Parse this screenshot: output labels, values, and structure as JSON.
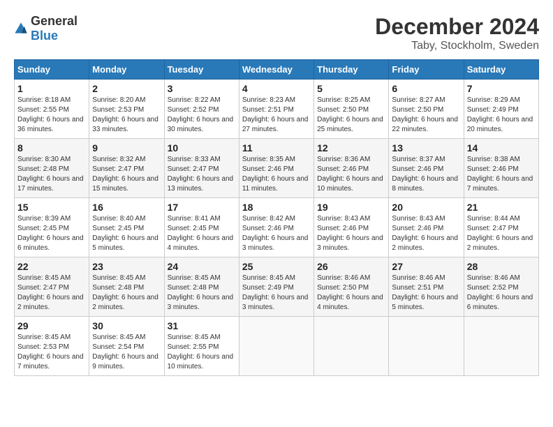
{
  "logo": {
    "general": "General",
    "blue": "Blue"
  },
  "title": "December 2024",
  "subtitle": "Taby, Stockholm, Sweden",
  "headers": [
    "Sunday",
    "Monday",
    "Tuesday",
    "Wednesday",
    "Thursday",
    "Friday",
    "Saturday"
  ],
  "weeks": [
    [
      {
        "day": "1",
        "sunrise": "8:18 AM",
        "sunset": "2:55 PM",
        "daylight": "6 hours and 36 minutes."
      },
      {
        "day": "2",
        "sunrise": "8:20 AM",
        "sunset": "2:53 PM",
        "daylight": "6 hours and 33 minutes."
      },
      {
        "day": "3",
        "sunrise": "8:22 AM",
        "sunset": "2:52 PM",
        "daylight": "6 hours and 30 minutes."
      },
      {
        "day": "4",
        "sunrise": "8:23 AM",
        "sunset": "2:51 PM",
        "daylight": "6 hours and 27 minutes."
      },
      {
        "day": "5",
        "sunrise": "8:25 AM",
        "sunset": "2:50 PM",
        "daylight": "6 hours and 25 minutes."
      },
      {
        "day": "6",
        "sunrise": "8:27 AM",
        "sunset": "2:50 PM",
        "daylight": "6 hours and 22 minutes."
      },
      {
        "day": "7",
        "sunrise": "8:29 AM",
        "sunset": "2:49 PM",
        "daylight": "6 hours and 20 minutes."
      }
    ],
    [
      {
        "day": "8",
        "sunrise": "8:30 AM",
        "sunset": "2:48 PM",
        "daylight": "6 hours and 17 minutes."
      },
      {
        "day": "9",
        "sunrise": "8:32 AM",
        "sunset": "2:47 PM",
        "daylight": "6 hours and 15 minutes."
      },
      {
        "day": "10",
        "sunrise": "8:33 AM",
        "sunset": "2:47 PM",
        "daylight": "6 hours and 13 minutes."
      },
      {
        "day": "11",
        "sunrise": "8:35 AM",
        "sunset": "2:46 PM",
        "daylight": "6 hours and 11 minutes."
      },
      {
        "day": "12",
        "sunrise": "8:36 AM",
        "sunset": "2:46 PM",
        "daylight": "6 hours and 10 minutes."
      },
      {
        "day": "13",
        "sunrise": "8:37 AM",
        "sunset": "2:46 PM",
        "daylight": "6 hours and 8 minutes."
      },
      {
        "day": "14",
        "sunrise": "8:38 AM",
        "sunset": "2:46 PM",
        "daylight": "6 hours and 7 minutes."
      }
    ],
    [
      {
        "day": "15",
        "sunrise": "8:39 AM",
        "sunset": "2:45 PM",
        "daylight": "6 hours and 6 minutes."
      },
      {
        "day": "16",
        "sunrise": "8:40 AM",
        "sunset": "2:45 PM",
        "daylight": "6 hours and 5 minutes."
      },
      {
        "day": "17",
        "sunrise": "8:41 AM",
        "sunset": "2:45 PM",
        "daylight": "6 hours and 4 minutes."
      },
      {
        "day": "18",
        "sunrise": "8:42 AM",
        "sunset": "2:46 PM",
        "daylight": "6 hours and 3 minutes."
      },
      {
        "day": "19",
        "sunrise": "8:43 AM",
        "sunset": "2:46 PM",
        "daylight": "6 hours and 3 minutes."
      },
      {
        "day": "20",
        "sunrise": "8:43 AM",
        "sunset": "2:46 PM",
        "daylight": "6 hours and 2 minutes."
      },
      {
        "day": "21",
        "sunrise": "8:44 AM",
        "sunset": "2:47 PM",
        "daylight": "6 hours and 2 minutes."
      }
    ],
    [
      {
        "day": "22",
        "sunrise": "8:45 AM",
        "sunset": "2:47 PM",
        "daylight": "6 hours and 2 minutes."
      },
      {
        "day": "23",
        "sunrise": "8:45 AM",
        "sunset": "2:48 PM",
        "daylight": "6 hours and 2 minutes."
      },
      {
        "day": "24",
        "sunrise": "8:45 AM",
        "sunset": "2:48 PM",
        "daylight": "6 hours and 3 minutes."
      },
      {
        "day": "25",
        "sunrise": "8:45 AM",
        "sunset": "2:49 PM",
        "daylight": "6 hours and 3 minutes."
      },
      {
        "day": "26",
        "sunrise": "8:46 AM",
        "sunset": "2:50 PM",
        "daylight": "6 hours and 4 minutes."
      },
      {
        "day": "27",
        "sunrise": "8:46 AM",
        "sunset": "2:51 PM",
        "daylight": "6 hours and 5 minutes."
      },
      {
        "day": "28",
        "sunrise": "8:46 AM",
        "sunset": "2:52 PM",
        "daylight": "6 hours and 6 minutes."
      }
    ],
    [
      {
        "day": "29",
        "sunrise": "8:45 AM",
        "sunset": "2:53 PM",
        "daylight": "6 hours and 7 minutes."
      },
      {
        "day": "30",
        "sunrise": "8:45 AM",
        "sunset": "2:54 PM",
        "daylight": "6 hours and 9 minutes."
      },
      {
        "day": "31",
        "sunrise": "8:45 AM",
        "sunset": "2:55 PM",
        "daylight": "6 hours and 10 minutes."
      },
      null,
      null,
      null,
      null
    ]
  ]
}
